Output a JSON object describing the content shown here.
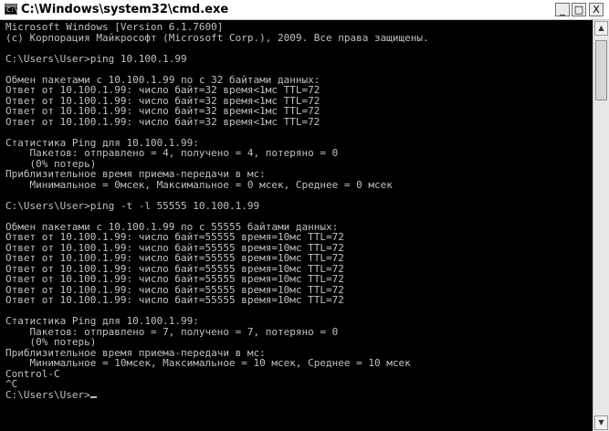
{
  "window": {
    "title": "C:\\Windows\\system32\\cmd.exe",
    "icon_glyph": "C:\\",
    "controls": {
      "minimize": "_",
      "maximize": "□",
      "close": "X"
    }
  },
  "scrollbar": {
    "up_arrow": "▲",
    "down_arrow": "▼"
  },
  "console": {
    "lines": [
      "Microsoft Windows [Version 6.1.7600]",
      "(c) Корпорация Майкрософт (Microsoft Corp.), 2009. Все права защищены.",
      "",
      "C:\\Users\\User>ping 10.100.1.99",
      "",
      "Обмен пакетами с 10.100.1.99 по с 32 байтами данных:",
      "Ответ от 10.100.1.99: число байт=32 время<1мс TTL=72",
      "Ответ от 10.100.1.99: число байт=32 время<1мс TTL=72",
      "Ответ от 10.100.1.99: число байт=32 время<1мс TTL=72",
      "Ответ от 10.100.1.99: число байт=32 время<1мс TTL=72",
      "",
      "Статистика Ping для 10.100.1.99:",
      "    Пакетов: отправлено = 4, получено = 4, потеряно = 0",
      "    (0% потерь)",
      "Приблизительное время приема-передачи в мс:",
      "    Минимальное = 0мсек, Максимальное = 0 мсек, Среднее = 0 мсек",
      "",
      "C:\\Users\\User>ping -t -l 55555 10.100.1.99",
      "",
      "Обмен пакетами с 10.100.1.99 по с 55555 байтами данных:",
      "Ответ от 10.100.1.99: число байт=55555 время=10мс TTL=72",
      "Ответ от 10.100.1.99: число байт=55555 время=10мс TTL=72",
      "Ответ от 10.100.1.99: число байт=55555 время=10мс TTL=72",
      "Ответ от 10.100.1.99: число байт=55555 время=10мс TTL=72",
      "Ответ от 10.100.1.99: число байт=55555 время=10мс TTL=72",
      "Ответ от 10.100.1.99: число байт=55555 время=10мс TTL=72",
      "Ответ от 10.100.1.99: число байт=55555 время=10мс TTL=72",
      "",
      "Статистика Ping для 10.100.1.99:",
      "    Пакетов: отправлено = 7, получено = 7, потеряно = 0",
      "    (0% потерь)",
      "Приблизительное время приема-передачи в мс:",
      "    Минимальное = 10мсек, Максимальное = 10 мсек, Среднее = 10 мсек",
      "Control-C",
      "^C",
      "C:\\Users\\User>"
    ]
  }
}
